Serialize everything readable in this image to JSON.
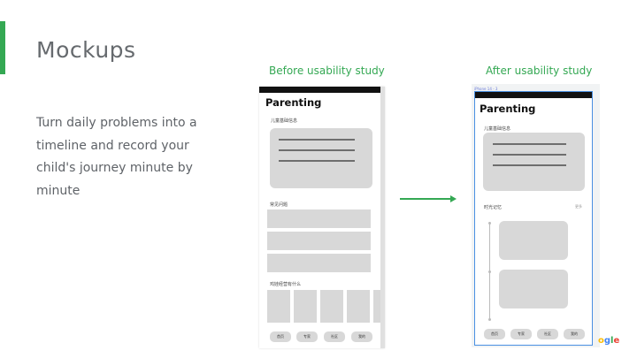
{
  "slide": {
    "title": "Mockups",
    "description": "Turn daily problems into a timeline and record your child's journey minute by minute",
    "label_before": "Before usability study",
    "label_after": "After usability study"
  },
  "before": {
    "app_title": "Parenting",
    "section1": "儿童基础信息",
    "section2": "常见问题",
    "section3": "鸡娃经营有什么",
    "tabs": [
      "首页",
      "专家",
      "社区",
      "我的"
    ]
  },
  "after": {
    "frame_label": "iPhone 14 - 3",
    "app_title": "Parenting",
    "section1": "儿童基础信息",
    "section2": "时光记忆",
    "more": "更多",
    "tabs": [
      "首页",
      "专家",
      "社区",
      "我的"
    ]
  },
  "logo": {
    "text": "ogle"
  },
  "colors": {
    "accent": "#34a853",
    "frame": "#4a90e2",
    "placeholder": "#d8d8d8"
  }
}
